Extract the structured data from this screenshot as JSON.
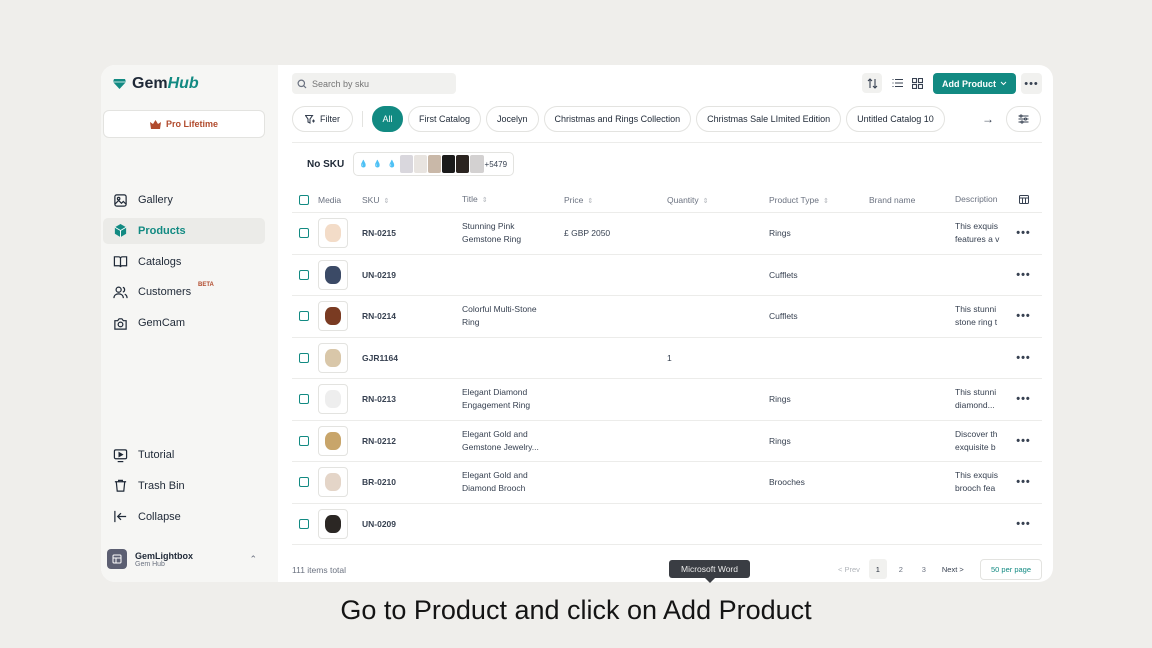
{
  "brand": {
    "name_a": "Gem",
    "name_b": "Hub",
    "accent": "#128a82",
    "pro_color": "#b14b2d"
  },
  "sidebar": {
    "pro_label": "Pro Lifetime",
    "items": [
      {
        "label": "Gallery",
        "icon": "image-icon"
      },
      {
        "label": "Products",
        "icon": "cube-icon"
      },
      {
        "label": "Catalogs",
        "icon": "book-icon"
      },
      {
        "label": "Customers",
        "icon": "users-icon",
        "badge": "BETA"
      },
      {
        "label": "GemCam",
        "icon": "camera-icon"
      }
    ],
    "bottom_items": [
      {
        "label": "Tutorial",
        "icon": "monitor-play-icon"
      },
      {
        "label": "Trash Bin",
        "icon": "trash-icon"
      },
      {
        "label": "Collapse",
        "icon": "collapse-icon"
      }
    ],
    "account": {
      "name": "GemLightbox",
      "sub": "Gem Hub"
    }
  },
  "toolbar": {
    "search_placeholder": "Search by sku",
    "add_product_label": "Add Product"
  },
  "filters": {
    "filter_label": "Filter",
    "chips": [
      "All",
      "First Catalog",
      "Jocelyn",
      "Christmas and Rings Collection",
      "Christmas Sale LImited Edition",
      "Untitled Catalog 10"
    ]
  },
  "nosku": {
    "label": "No SKU",
    "more": "+5479"
  },
  "table": {
    "headers": [
      "Media",
      "SKU",
      "Title",
      "Price",
      "Quantity",
      "Product Type",
      "Brand name",
      "Description"
    ],
    "rows": [
      {
        "sku": "RN-0215",
        "title1": "Stunning Pink",
        "title2": "Gemstone Ring",
        "price": "£ GBP 2050",
        "qty": "",
        "type": "Rings",
        "desc1": "This exquis",
        "desc2": "features a v"
      },
      {
        "sku": "UN-0219",
        "title1": "",
        "title2": "",
        "price": "",
        "qty": "",
        "type": "Cufflets",
        "desc1": "",
        "desc2": ""
      },
      {
        "sku": "RN-0214",
        "title1": "Colorful Multi-Stone",
        "title2": "Ring",
        "price": "",
        "qty": "",
        "type": "Cufflets",
        "desc1": "This stunni",
        "desc2": "stone ring t"
      },
      {
        "sku": "GJR1164",
        "title1": "",
        "title2": "",
        "price": "",
        "qty": "1",
        "type": "",
        "desc1": "",
        "desc2": ""
      },
      {
        "sku": "RN-0213",
        "title1": "Elegant Diamond",
        "title2": "Engagement Ring",
        "price": "",
        "qty": "",
        "type": "Rings",
        "desc1": "This stunni",
        "desc2": "diamond..."
      },
      {
        "sku": "RN-0212",
        "title1": "Elegant Gold and",
        "title2": "Gemstone Jewelry...",
        "price": "",
        "qty": "",
        "type": "Rings",
        "desc1": "Discover th",
        "desc2": "exquisite b"
      },
      {
        "sku": "BR-0210",
        "title1": "Elegant Gold and",
        "title2": "Diamond Brooch",
        "price": "",
        "qty": "",
        "type": "Brooches",
        "desc1": "This exquis",
        "desc2": "brooch fea"
      },
      {
        "sku": "UN-0209",
        "title1": "",
        "title2": "",
        "price": "",
        "qty": "",
        "type": "",
        "desc1": "",
        "desc2": ""
      }
    ]
  },
  "footer": {
    "total": "111 items total",
    "prev": "< Prev",
    "pages": [
      "1",
      "2",
      "3"
    ],
    "next": "Next >",
    "per_page": "50 per page"
  },
  "tooltip": "Microsoft Word",
  "caption": "Go to Product and click on Add Product"
}
